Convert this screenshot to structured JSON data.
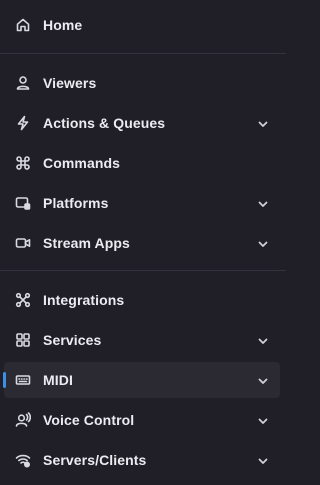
{
  "sidebar": {
    "items": [
      {
        "label": "Home",
        "icon": "home-icon",
        "has_submenu": false
      },
      {
        "label": "Viewers",
        "icon": "user-icon",
        "has_submenu": false
      },
      {
        "label": "Actions & Queues",
        "icon": "lightning-icon",
        "has_submenu": true
      },
      {
        "label": "Commands",
        "icon": "command-icon",
        "has_submenu": false
      },
      {
        "label": "Platforms",
        "icon": "platforms-icon",
        "has_submenu": true
      },
      {
        "label": "Stream Apps",
        "icon": "video-icon",
        "has_submenu": true
      },
      {
        "label": "Integrations",
        "icon": "integrations-icon",
        "has_submenu": false
      },
      {
        "label": "Services",
        "icon": "grid-icon",
        "has_submenu": true
      },
      {
        "label": "MIDI",
        "icon": "keyboard-icon",
        "has_submenu": true,
        "active": true
      },
      {
        "label": "Voice Control",
        "icon": "voice-icon",
        "has_submenu": true
      },
      {
        "label": "Servers/Clients",
        "icon": "wifi-gear-icon",
        "has_submenu": true
      }
    ]
  },
  "colors": {
    "background": "#201f27",
    "active_background": "#2b2a33",
    "accent": "#3b8eea",
    "divider": "#34333d"
  }
}
